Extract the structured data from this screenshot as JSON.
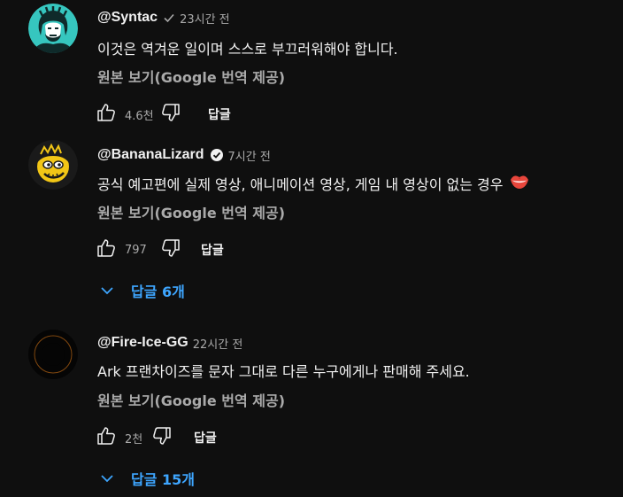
{
  "comments": [
    {
      "author": "@Syntac",
      "verified": true,
      "time": "23시간 전",
      "text": "이것은 역겨운 일이며 스스로 부끄러워해야 합니다.",
      "translate_label": "원본 보기(Google 번역 제공)",
      "likes": "4.6천",
      "reply_label": "답글",
      "avatar_icon": "aquaman-avatar-icon",
      "avatar_bg": "#36c6bf"
    },
    {
      "author": "@BananaLizard",
      "creator_badge": true,
      "time": "7시간 전",
      "text": "공식 예고편에 실제 영상, 애니메이션 영상, 게임 내 영상이 없는 경우",
      "emoji": "lips-emoji-icon",
      "translate_label": "원본 보기(Google 번역 제공)",
      "likes": "797",
      "reply_label": "답글",
      "replies_label": "답글 6개",
      "avatar_icon": "yellow-lizard-avatar-icon"
    },
    {
      "author": "@Fire-Ice-GG",
      "time": "22시간 전",
      "text": "Ark 프랜차이즈를 문자 그대로 다른 누구에게나 판매해 주세요.",
      "translate_label": "원본 보기(Google 번역 제공)",
      "likes": "2천",
      "reply_label": "답글",
      "replies_label": "답글 15개",
      "avatar_icon": "fire-ice-ring-avatar-icon"
    }
  ],
  "colors": {
    "background": "#0f0f0f",
    "text": "#f1f1f1",
    "secondary_text": "#aaaaaa",
    "link_blue": "#3ea6ff"
  },
  "icons": [
    "thumbs-up-icon",
    "thumbs-down-icon",
    "chevron-down-icon",
    "verified-check-icon",
    "creator-check-icon"
  ]
}
